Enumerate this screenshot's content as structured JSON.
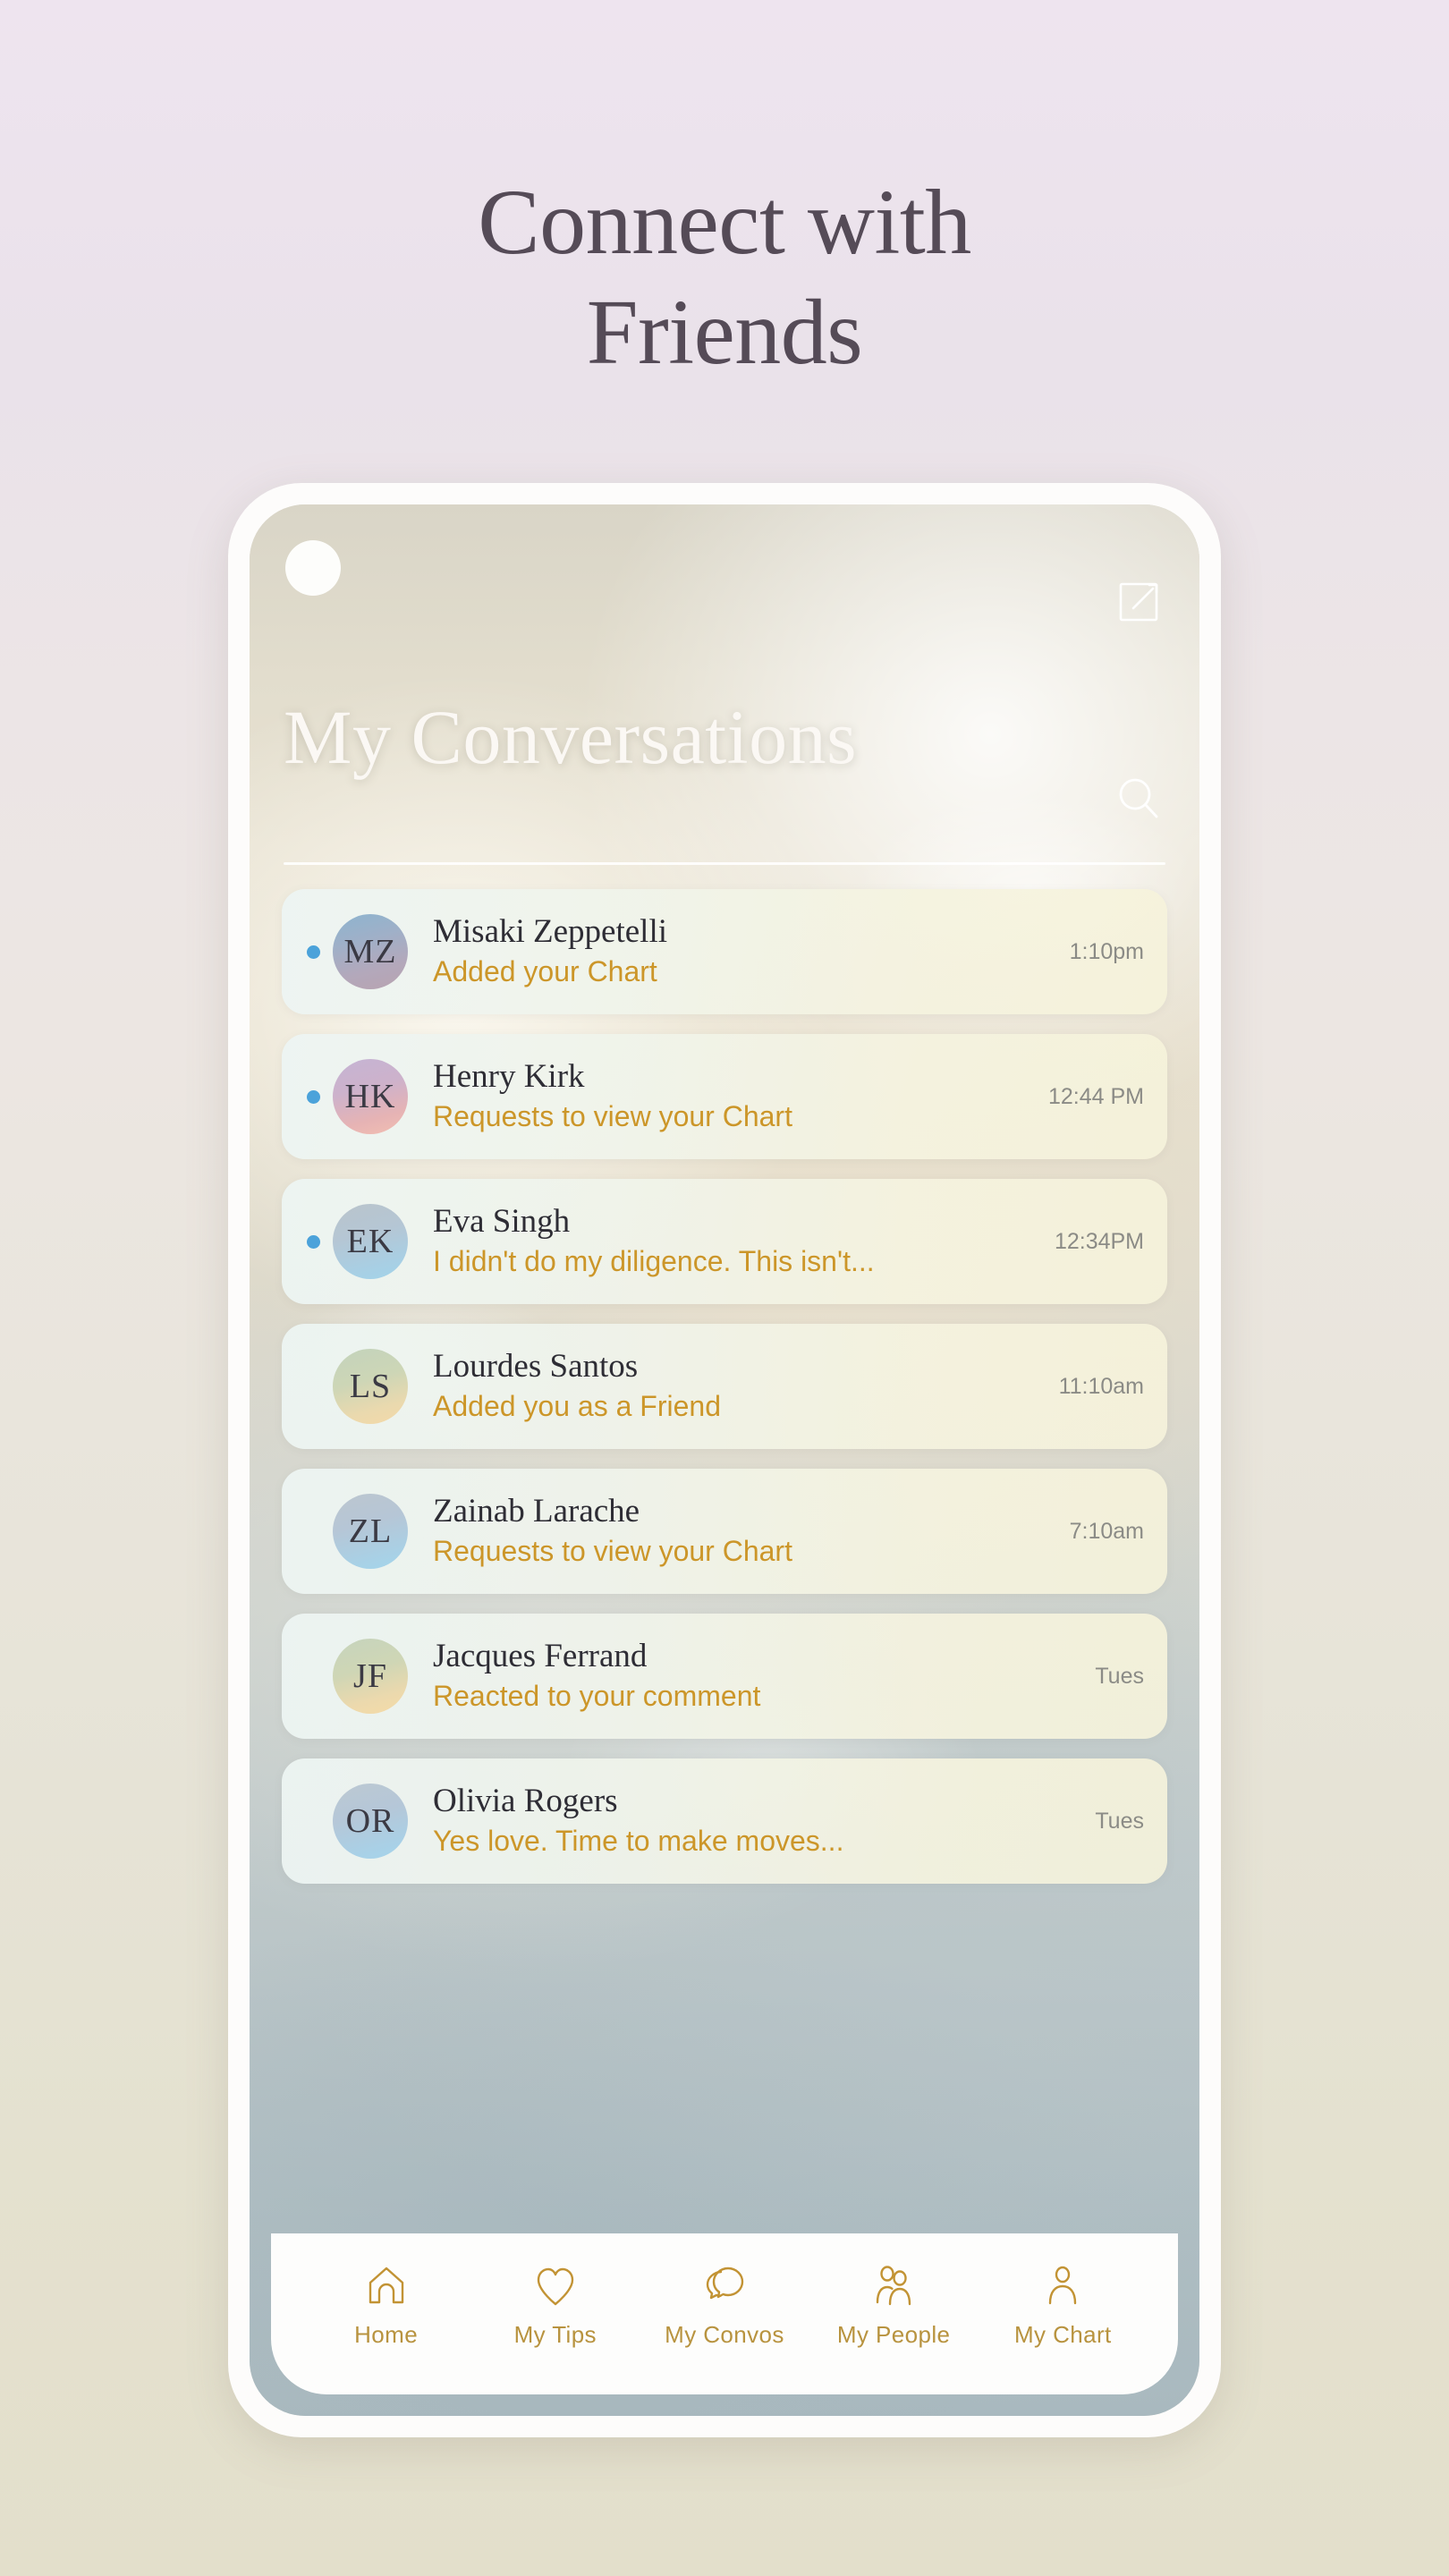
{
  "page": {
    "headline_line1": "Connect with",
    "headline_line2": "Friends",
    "headline_color": "#554b57",
    "bg_top_color": "#eee4ef",
    "bg_bottom_color": "#e3dfcb"
  },
  "app": {
    "header": {
      "title": "My Conversations",
      "profile_avatar": "profile-avatar",
      "compose_icon": "compose-icon",
      "search_icon": "search-icon",
      "title_color": "#fbf8f4"
    },
    "accent": {
      "preview_gold": "#cc9629",
      "unread_blue": "#4ba2da",
      "nav_gold": "#b8933f",
      "timestamp_gray": "#8b8b86"
    },
    "conversations": [
      {
        "initials": "MZ",
        "name": "Misaki Zeppetelli",
        "preview": "Added your Chart",
        "time": "1:10pm",
        "unread": true,
        "avatar_class": "av-mz"
      },
      {
        "initials": "HK",
        "name": "Henry Kirk",
        "preview": "Requests to view your Chart",
        "time": "12:44 PM",
        "unread": true,
        "avatar_class": "av-hk"
      },
      {
        "initials": "EK",
        "name": "Eva Singh",
        "preview": "I didn't do my diligence. This isn't...",
        "time": "12:34PM",
        "unread": true,
        "avatar_class": "av-ek"
      },
      {
        "initials": "LS",
        "name": "Lourdes Santos",
        "preview": "Added you as a Friend",
        "time": "11:10am",
        "unread": false,
        "avatar_class": "av-ls"
      },
      {
        "initials": "ZL",
        "name": "Zainab Larache",
        "preview": "Requests to view your Chart",
        "time": "7:10am",
        "unread": false,
        "avatar_class": "av-zl"
      },
      {
        "initials": "JF",
        "name": "Jacques Ferrand",
        "preview": "Reacted to your comment",
        "time": "Tues",
        "unread": false,
        "avatar_class": "av-jf"
      },
      {
        "initials": "OR",
        "name": "Olivia Rogers",
        "preview": "Yes love.  Time to make moves...",
        "time": "Tues",
        "unread": false,
        "avatar_class": "av-or"
      }
    ],
    "bottom_nav": [
      {
        "label": "Home",
        "icon": "home-icon"
      },
      {
        "label": "My Tips",
        "icon": "heart-icon"
      },
      {
        "label": "My Convos",
        "icon": "chat-bubbles-icon"
      },
      {
        "label": "My People",
        "icon": "two-people-icon"
      },
      {
        "label": "My Chart",
        "icon": "person-icon"
      }
    ]
  }
}
